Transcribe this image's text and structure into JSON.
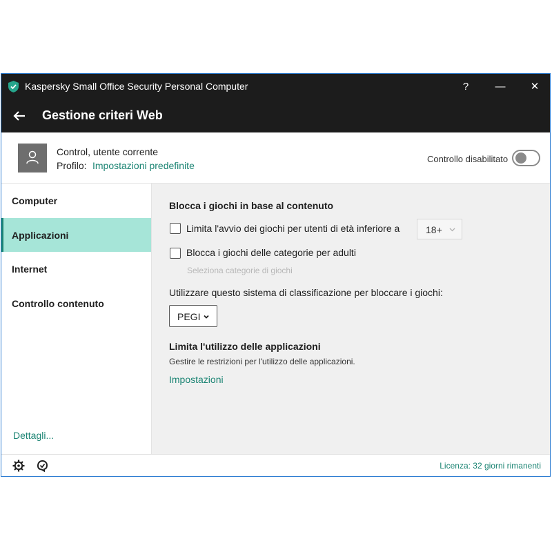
{
  "window": {
    "app_title": "Kaspersky Small Office Security Personal Computer"
  },
  "titlebar_buttons": {
    "help": "?",
    "minimize": "—",
    "close": "✕"
  },
  "header": {
    "page_title": "Gestione criteri Web"
  },
  "profile": {
    "user_name": "Control, utente corrente",
    "profile_label": "Profilo:",
    "profile_link": "Impostazioni predefinite",
    "toggle_label": "Controllo disabilitato",
    "toggle_on": false
  },
  "sidebar": {
    "items": [
      {
        "label": "Computer",
        "active": false
      },
      {
        "label": "Applicazioni",
        "active": true
      },
      {
        "label": "Internet",
        "active": false
      },
      {
        "label": "Controllo contenuto",
        "active": false
      }
    ],
    "details_link": "Dettagli..."
  },
  "content": {
    "block_games_title": "Blocca i giochi in base al contenuto",
    "age_limit_label": "Limita l'avvio dei giochi per utenti di età inferiore a",
    "age_limit_checked": false,
    "age_value": "18+",
    "adult_categories_label": "Blocca i giochi delle categorie per adulti",
    "adult_categories_checked": false,
    "select_categories_link": "Seleziona categorie di giochi",
    "rating_system_label": "Utilizzare questo sistema di classificazione per bloccare i giochi:",
    "rating_system_value": "PEGI",
    "limit_apps_title": "Limita l'utilizzo delle applicazioni",
    "limit_apps_desc": "Gestire le restrizioni per l'utilizzo delle applicazioni.",
    "settings_link": "Impostazioni"
  },
  "footer": {
    "license": "Licenza: 32 giorni rimanenti"
  },
  "icons": {
    "logo": "kaspersky-shield-icon",
    "back": "arrow-left-icon",
    "avatar": "user-icon",
    "settings": "gear-icon",
    "support": "support-icon",
    "select": "chevron-down-icon"
  },
  "colors": {
    "accent": "#1b8473",
    "active_nav_bg": "#a6e5d8",
    "titlebar_bg": "#1c1c1c",
    "content_bg": "#f0f0f0",
    "window_border": "#2b7bd1"
  }
}
